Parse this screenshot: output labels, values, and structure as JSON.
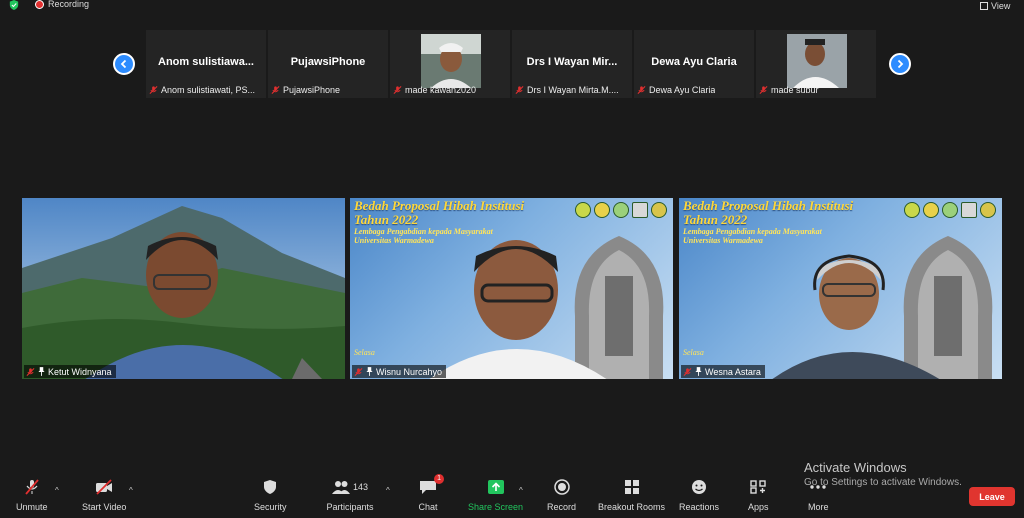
{
  "topbar": {
    "recording_label": "Recording",
    "view_label": "View"
  },
  "gallery": {
    "thumbnails": [
      {
        "display_name": "Anom  sulistiawa...",
        "footer_name": "Anom sulistiawati,  PS..."
      },
      {
        "display_name": "PujawsiPhone",
        "footer_name": "PujawsiPhone"
      },
      {
        "display_name": "",
        "footer_name": "made kawan2020"
      },
      {
        "display_name": "Drs  I  Wayan  Mir...",
        "footer_name": "Drs I Wayan Mirta.M...."
      },
      {
        "display_name": "Dewa Ayu Claria",
        "footer_name": "Dewa Ayu Claria"
      },
      {
        "display_name": "",
        "footer_name": "made subur"
      }
    ]
  },
  "tiles": [
    {
      "name": "Ketut Widnyana"
    },
    {
      "name": "Wisnu Nurcahyo"
    },
    {
      "name": "Wesna Astara"
    }
  ],
  "slide": {
    "title_line1": "Bedah Proposal Hibah Institusi",
    "title_line2": "Tahun 2022",
    "sub_line1": "Lembaga Pengabdian kepada Masyarakat",
    "sub_line2": "Universitas Warmadewa",
    "day": "Selasa"
  },
  "toolbar": {
    "unmute": "Unmute",
    "start_video": "Start Video",
    "security": "Security",
    "participants": "Participants",
    "participants_count": "143",
    "chat": "Chat",
    "chat_badge": "1",
    "share_screen": "Share Screen",
    "record": "Record",
    "breakout_rooms": "Breakout Rooms",
    "reactions": "Reactions",
    "apps": "Apps",
    "more": "More",
    "leave": "Leave"
  },
  "watermark": {
    "title": "Activate Windows",
    "subtitle": "Go to Settings to activate Windows."
  },
  "colors": {
    "accent": "#2d8cff",
    "share_green": "#22c55e",
    "leave_red": "#e0352f"
  }
}
